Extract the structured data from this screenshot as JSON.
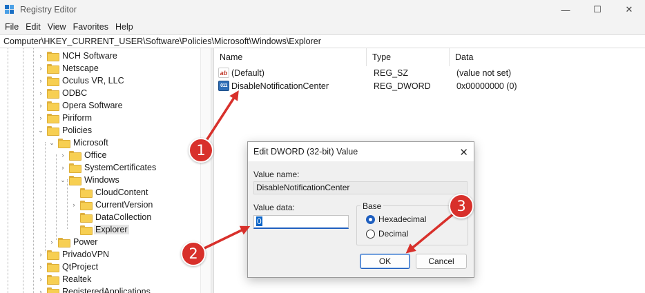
{
  "window": {
    "title": "Registry Editor",
    "controls": {
      "minimize": "—",
      "maximize": "☐",
      "close": "✕"
    }
  },
  "menu": [
    "File",
    "Edit",
    "View",
    "Favorites",
    "Help"
  ],
  "address": "Computer\\HKEY_CURRENT_USER\\Software\\Policies\\Microsoft\\Windows\\Explorer",
  "tree": [
    {
      "label": "NCH Software",
      "chevron": "›"
    },
    {
      "label": "Netscape",
      "chevron": "›"
    },
    {
      "label": "Oculus VR, LLC",
      "chevron": "›"
    },
    {
      "label": "ODBC",
      "chevron": "›"
    },
    {
      "label": "Opera Software",
      "chevron": "›"
    },
    {
      "label": "Piriform",
      "chevron": "›"
    },
    {
      "label": "Policies",
      "chevron": "⌄"
    },
    {
      "label": "Microsoft",
      "chevron": "⌄"
    },
    {
      "label": "Office",
      "chevron": "›"
    },
    {
      "label": "SystemCertificates",
      "chevron": "›"
    },
    {
      "label": "Windows",
      "chevron": "⌄"
    },
    {
      "label": "CloudContent",
      "chevron": ""
    },
    {
      "label": "CurrentVersion",
      "chevron": "›"
    },
    {
      "label": "DataCollection",
      "chevron": ""
    },
    {
      "label": "Explorer",
      "chevron": ""
    },
    {
      "label": "Power",
      "chevron": "›"
    },
    {
      "label": "PrivadoVPN",
      "chevron": "›"
    },
    {
      "label": "QtProject",
      "chevron": "›"
    },
    {
      "label": "Realtek",
      "chevron": "›"
    },
    {
      "label": "RegisteredApplications",
      "chevron": "›"
    }
  ],
  "list": {
    "headers": {
      "name": "Name",
      "type": "Type",
      "data": "Data"
    },
    "rows": [
      {
        "name": "(Default)",
        "type": "REG_SZ",
        "data": "(value not set)",
        "icon": "ab",
        "icon_name": "string-value-icon"
      },
      {
        "name": "DisableNotificationCenter",
        "type": "REG_DWORD",
        "data": "0x00000000 (0)",
        "icon": "011",
        "icon_name": "dword-value-icon"
      }
    ]
  },
  "dialog": {
    "title": "Edit DWORD (32-bit) Value",
    "close": "✕",
    "value_name_label": "Value name:",
    "value_name": "DisableNotificationCenter",
    "value_data_label": "Value data:",
    "value_data": "0",
    "base_label": "Base",
    "base_hex": "Hexadecimal",
    "base_dec": "Decimal",
    "base_selected": "Hexadecimal",
    "ok": "OK",
    "cancel": "Cancel"
  },
  "annotations": {
    "color": "#d8302b",
    "badges": [
      "1",
      "2",
      "3"
    ]
  }
}
